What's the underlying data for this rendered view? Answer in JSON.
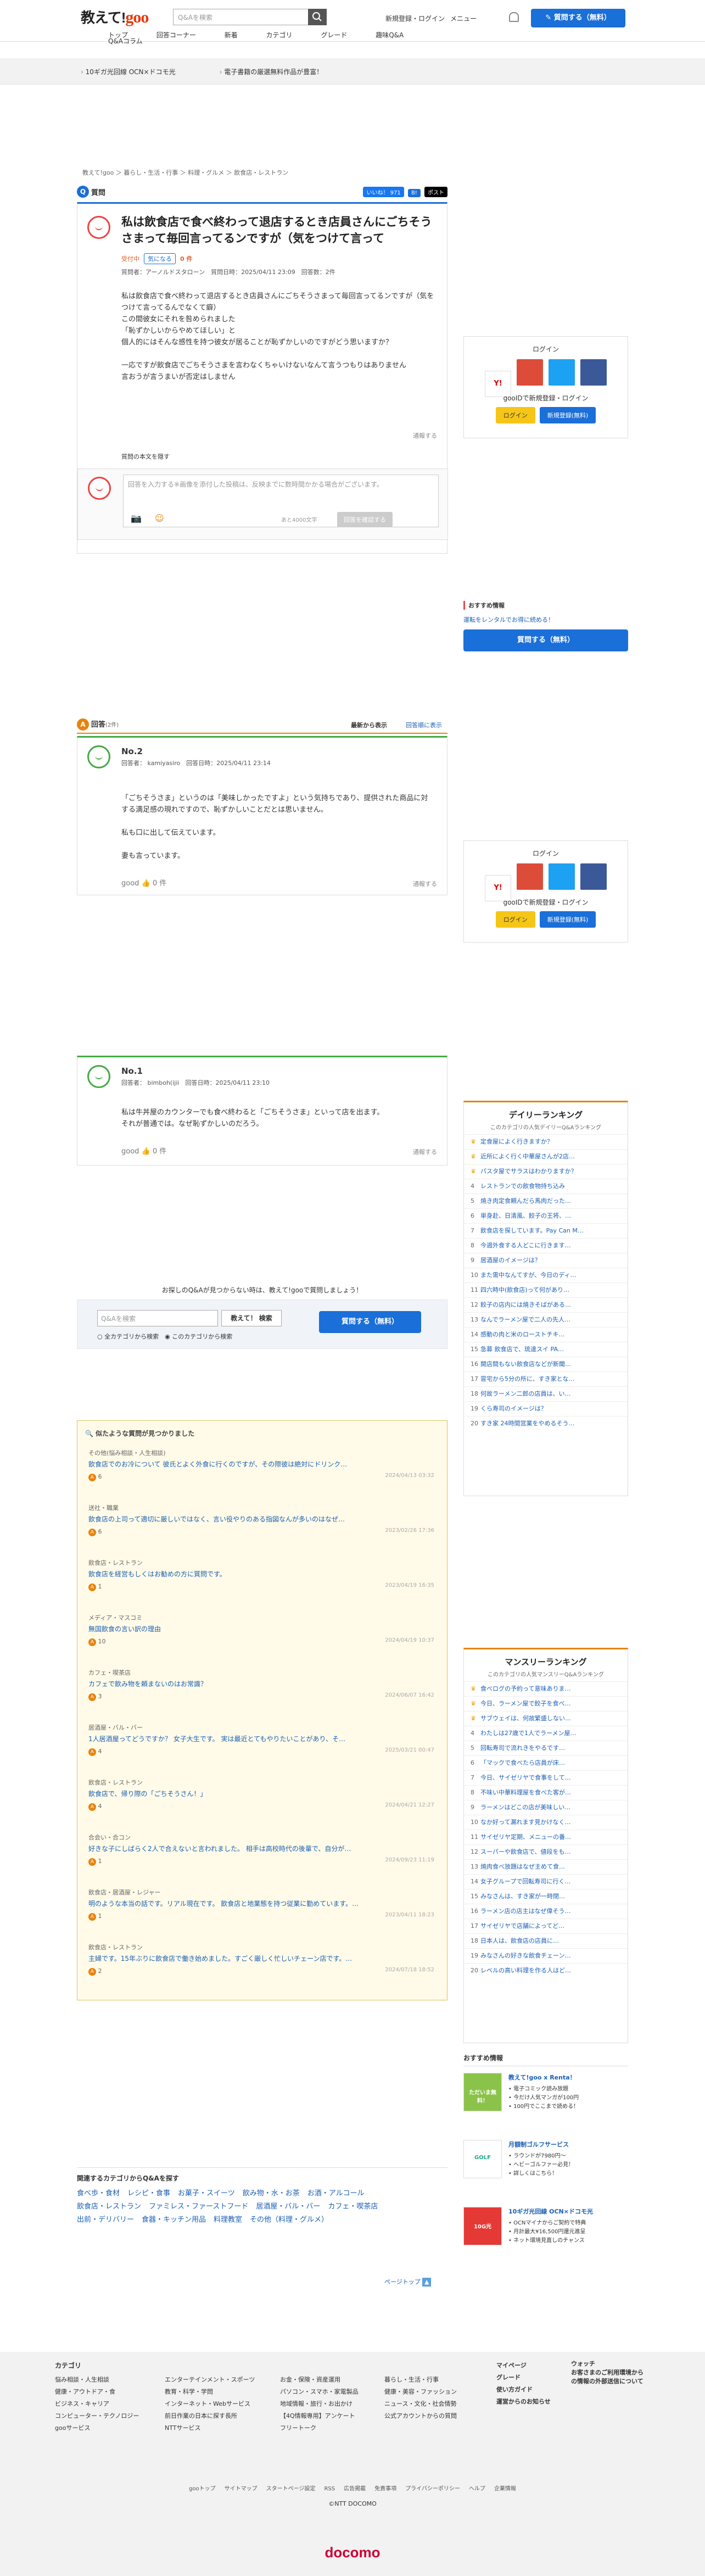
{
  "header": {
    "logo_text": "教えて!",
    "logo_brand": "goo",
    "search_placeholder": "Q&Aを検索",
    "login": "新規登録・ログイン",
    "menu": "メニュー",
    "ask_button": "質問する（無料）",
    "nav": [
      "トップ",
      "回答コーナー",
      "新着",
      "カテゴリ",
      "グレード",
      "趣味Q&A"
    ],
    "nav2": "Q&Aコラム"
  },
  "promos": [
    "10ギガ光回線 OCN×ドコモ光",
    "電子書籍の厳選無料作品が豊富！"
  ],
  "breadcrumb": "教えて!goo ＞ 暮らし・生活・行事 ＞ 料理・グルメ ＞ 飲食店・レストラン",
  "question": {
    "section_label": "質問",
    "icon": "Q",
    "social": [
      "いいね！ 971",
      "B!",
      "ポスト"
    ],
    "title": "私は飲食店で食べ終わって退店するとき店員さんにごちそうさまって毎回言ってるンですが（気をつけて言って",
    "status": "受付中",
    "tag": "気になる",
    "count": "0 件",
    "meta": "質問者：アーノルドスタローン　質問日時：2025/04/11 23:09　回答数：2件",
    "body": "私は飲食店で食べ終わって退店するとき店員さんにごちそうさまって毎回言ってるンですが（気をつけて言ってるんでなくて癖）\nこの間彼女にそれを咎められました\n「恥ずかしいからやめてほしい」と\n個人的にはそんな感性を持つ彼女が居ることが恥ずかしいのですがどう思いますか？\n\n一応ですが飲食店でごちそうさまを言わなくちゃいけないなんて言うつもりはありません\n言おうが言うまいが否定はしません",
    "report": "通報する",
    "full_text_link": "質問の本文を隠す",
    "reply_placeholder": "回答を入力する※画像を添付した投稿は、反映までに数時間かかる場合がございます。",
    "char_limit": "あと4000文字",
    "confirm_button": "回答を確認する"
  },
  "login_box": {
    "title": "ログイン",
    "sub": "gooIDで新規登録・ログイン",
    "login_btn": "ログイン",
    "register_btn": "新規登録(無料)"
  },
  "recommend": {
    "title": "おすすめ情報",
    "link": "運転をレンタルでお得に続める！",
    "ask_button": "質問する（無料）"
  },
  "answers": {
    "label": "回答",
    "count": "(2件)",
    "sort_new": "最新から表示",
    "sort_old": "回答順に表示",
    "items": [
      {
        "no": "No.2",
        "meta": "回答者：  kamiyasiro　回答日時：2025/04/11 23:14",
        "body": "「ごちそうさま」というのは「美味しかったですよ」という気持ちであり、提供された商品に対する満足感の現れですので、恥ずかしいことだとは思いません。\n\n私も口に出して伝えています。\n\n妻も言っています。",
        "good": "good",
        "good_count": "0 件",
        "report": "通報する"
      },
      {
        "no": "No.1",
        "meta": "回答者：  bimboh(ijii　回答日時：2025/04/11 23:10",
        "body": "私は牛丼屋のカウンターでも食べ終わると「ごちそうさま」といって店を出ます。\nそれが普通では。なぜ恥ずかしいのだろう。",
        "good": "good",
        "good_count": "0 件",
        "report": "通報する"
      }
    ]
  },
  "search_again": {
    "lead": "お探しのQ&Aが見つからない時は、教えて!gooで質問しましょう！",
    "placeholder": "Q&Aを検索",
    "search_btn": "教えて！ 検索",
    "opt1": "全カテゴリから検索",
    "opt2": "このカテゴリから検索",
    "ask_button": "質問する（無料）"
  },
  "related": {
    "title": "似たような質問が見つかりました",
    "items": [
      {
        "cat": "その他(悩み相談・人生相談)",
        "q": "飲食店でのお冷について 彼氏とよく外食に行くのですが、その際彼は絶対にドリンク…",
        "date": "2024/04/13 03:32",
        "n": "6"
      },
      {
        "cat": "送社・職業",
        "q": "飲食店の上司って適切に厳しいではなく、言い役やりのある指図なんが多いのはなぜ…",
        "date": "2023/02/26 17:36",
        "n": "6"
      },
      {
        "cat": "飲食店・レストラン",
        "q": "飲食店を経営もしくはお勧めの方に質問です。",
        "date": "2023/04/19 16:35",
        "n": "1"
      },
      {
        "cat": "メディア・マスコミ",
        "q": "無国飲食の言い訳の理由",
        "date": "2024/04/19 10:37",
        "n": "10"
      },
      {
        "cat": "カフェ・喫茶店",
        "q": "カフェで飲み物を頼まないのはお常識？",
        "date": "2024/06/07 16:42",
        "n": "3"
      },
      {
        "cat": "居酒屋・バル・バー",
        "q": "1人居酒屋ってどうですか？ 女子大生です。 実は最近とてもやりたいことがあり、そ…",
        "date": "2025/03/21 00:47",
        "n": "4"
      },
      {
        "cat": "飲食店・レストラン",
        "q": "飲食店で、帰り際の「ごちそうさん！」",
        "date": "2024/04/21 12:27",
        "n": "4"
      },
      {
        "cat": "合会い・合コン",
        "q": "好きな子にしばらく2人で合えないと言われました。 相手は高校時代の後輩で、自分が…",
        "date": "2024/09/23 11:19",
        "n": "1"
      },
      {
        "cat": "飲食店・居酒屋・レジャー",
        "q": "明のような本当の話です。リアル現在です。 飲食店と地業態を持つ従業に勤めています。…",
        "date": "2023/04/11 18:23",
        "n": "1"
      },
      {
        "cat": "飲食店・レストラン",
        "q": "主婦です。15年ぶりに飲食店で働き始めました。すごく厳しく忙しいチェーン店です。…",
        "date": "2024/07/18 18:52",
        "n": "2"
      }
    ]
  },
  "daily_ranking": {
    "title": "デイリーランキング",
    "sub": "このカテゴリの人気デイリーQ&Aランキング",
    "items": [
      "定食屋によく行きますか？",
      "近所によく行く中華屋さんが2店…",
      "パスタ屋でサラスはわかりますか？",
      "レストランでの飲食物持ち込み",
      "焼き肉定食頼んだら馬肉だった…",
      "単身赴、日清風、餃子の王将、…",
      "飲食店を探しています。Pay Can M…",
      "今週外食する人どこに行きます…",
      "居酒屋のイメージは？",
      "また需中なんてすが、今日のディ…",
      "四六時中(飲食店)って何があり…",
      "餃子の店内には焼きそばがある…",
      "なんでラーメン屋で二人の先人…",
      "感動の肉と米のローストチキ…",
      "急募 飲食店で、琉達スイ PA…",
      "開店間もない飲食店などが新聞…",
      "冒宅から5分の所に、すき家とな…",
      "何故ラーメン二郎の店員は、い…",
      "くら寿司のイメージは？",
      "すき家 24時間営業をやめるそう…"
    ]
  },
  "monthly_ranking": {
    "title": "マンスリーランキング",
    "sub": "このカテゴリの人気マンスリーQ&Aランキング",
    "items": [
      "食べログの予約って意味ありま…",
      "今日、ラーメン屋で餃子を食べ…",
      "サブウェイは、何故繁盛しない…",
      "わたしは27歳で1人でラーメン屋…",
      "回転寿司で流れきをやるです…",
      "「マックで食べたら店員が床…",
      "今日、サイゼリヤで食事をして…",
      "不味い中華料理屋を食べた客が…",
      "ラーメンはどこの店が美味しい…",
      "なか好って漏れます見かけなく…",
      "サイゼリヤ定期、メニューの番…",
      "スーパーや飲食店で、値段をも…",
      "焼肉食べ放題はなぜ主めて食…",
      "女子グループで回転寿司に行く…",
      "みなさんは、すき家が一時閉…",
      "ラーメン店の店主はなぜ偉そう…",
      "サイゼリヤで店舗によってど…",
      "日本人は、飲食店の店員に…",
      "みなさんの好きな飲食チェーン…",
      "レベルの高い料理を作る人はど…"
    ]
  },
  "sponsored": {
    "title": "おすすめ情報",
    "items": [
      {
        "badge": "ただいま無料！",
        "title": "教えて!goo x Renta！",
        "lines": [
          "電子コミック読み放題",
          "今だけ人気マンガが100円",
          "100円でここまで読める！"
        ]
      },
      {
        "badge": "GOLF",
        "title": "月額制ゴルフサービス",
        "lines": [
          "ラウンドが7980円～",
          "ヘビーゴルファー必見！",
          "詳しくはこちら！"
        ]
      },
      {
        "badge": "10G光",
        "title": "10ギガ光回線 OCN×ドコモ光",
        "lines": [
          "OCNマイナからご契約で特典",
          "月計最大¥16,500円還元進呈",
          "ネット環境見直しのチャンス"
        ]
      }
    ]
  },
  "categories": {
    "title": "関連するカテゴリからQ&Aを探す",
    "items": [
      "食べ歩・食材",
      "レシピ・食事",
      "お菓子・スイーツ",
      "飲み物・水・お茶",
      "お酒・アルコール",
      "飲食店・レストラン",
      "ファミレス・ファーストフード",
      "居酒屋・バル・バー",
      "カフェ・喫茶店",
      "出前・デリバリー",
      "食器・キッチン用品",
      "料理教室",
      "その他（料理・グルメ）"
    ]
  },
  "page_top": "ページトップ",
  "footer": {
    "cat_title": "カテゴリ",
    "col1": [
      "悩み相談・人生相談",
      "健康・アウトドア・食",
      "ビジネス・キャリア",
      "コンピューター・テクノロジー",
      "gooサービス"
    ],
    "col2": [
      "エンターテインメント・スポーツ",
      "教育・科学・学問",
      "インターネット・Webサービス",
      "前日作業の日本に探す長所",
      "NTTサービス"
    ],
    "col3": [
      "お金・保険・資産運用",
      "パソコン・スマホ・家電製品",
      "地域情報・旅行・お出かけ",
      "【4Q情報専用】アンケート",
      "フリートーク"
    ],
    "col4": [
      "暮らし・生活・行事",
      "健康・美容・ファッション",
      "ニュース・文化・社会情勢",
      "公式アカウントからの質問"
    ],
    "col5": [
      "マイページ",
      "グレード",
      "使い方ガイド",
      "運営からのお知らせ"
    ],
    "col6": [
      "ウォッチ",
      "お客さまのご利用環境からの情報の外部送信について"
    ],
    "bottom_links": [
      "gooトップ",
      "サイトマップ",
      "スタートページ設定",
      "RSS",
      "広告掲載",
      "免責事項",
      "プライバシーポリシー",
      "ヘルプ",
      "企業情報"
    ],
    "copyright": "©NTT DOCOMO",
    "docomo": "docomo"
  },
  "colors": {
    "accent": "#1a6fd8",
    "answer": "#e8830d",
    "brand": "#e8380d",
    "docomo": "#cc0033"
  }
}
